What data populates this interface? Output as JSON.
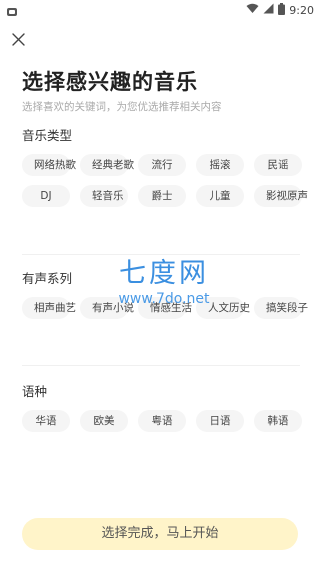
{
  "status_bar": {
    "time": "9:20",
    "left_icon": "notification-icon",
    "right_icons": [
      "wifi-icon",
      "signal-icon",
      "battery-icon"
    ]
  },
  "header": {
    "close_icon": "close-icon",
    "title": "选择感兴趣的音乐",
    "subtitle": "选择喜欢的关键词，为您优选推荐相关内容"
  },
  "sections": [
    {
      "title": "音乐类型",
      "tags": [
        "网络热歌",
        "经典老歌",
        "流行",
        "摇滚",
        "民谣",
        "DJ",
        "轻音乐",
        "爵士",
        "儿童",
        "影视原声"
      ]
    },
    {
      "title": "有声系列",
      "tags": [
        "相声曲艺",
        "有声小说",
        "情感生活",
        "人文历史",
        "搞笑段子"
      ]
    },
    {
      "title": "语种",
      "tags": [
        "华语",
        "欧美",
        "粤语",
        "日语",
        "韩语"
      ]
    }
  ],
  "watermark": {
    "main": "七度网",
    "url": "www.7do.net"
  },
  "footer": {
    "confirm_label": "选择完成，马上开始"
  },
  "colors": {
    "chip_bg": "#f5f5f5",
    "confirm_bg": "#fff4c9",
    "watermark": "#3b8fe0"
  }
}
